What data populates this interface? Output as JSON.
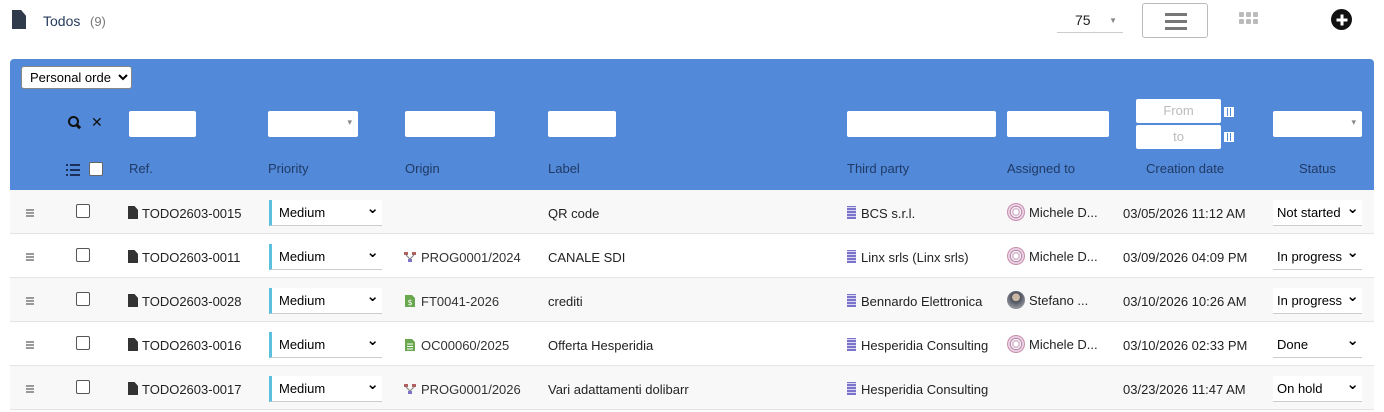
{
  "header": {
    "title": "Todos",
    "count": "(9)",
    "per_page": "75"
  },
  "filters": {
    "sort_option": "Personal order",
    "date_from": "From",
    "date_to": "to"
  },
  "columns": {
    "ref": "Ref.",
    "priority": "Priority",
    "origin": "Origin",
    "label": "Label",
    "third_party": "Third party",
    "assigned_to": "Assigned to",
    "creation_date": "Creation date",
    "status": "Status"
  },
  "rows": [
    {
      "ref": "TODO2603-0015",
      "priority": "Medium",
      "origin": "",
      "origin_icon": "",
      "label": "QR code",
      "third_party": "BCS s.r.l.",
      "assigned": "Michele D...",
      "avatar": "pink",
      "date": "03/05/2026 11:12 AM",
      "status": "Not started"
    },
    {
      "ref": "TODO2603-0011",
      "priority": "Medium",
      "origin": "PROG0001/2024",
      "origin_icon": "project-icon",
      "label": "CANALE SDI",
      "third_party": "Linx srls (Linx srls)",
      "assigned": "Michele D...",
      "avatar": "pink",
      "date": "03/09/2026 04:09 PM",
      "status": "In progress"
    },
    {
      "ref": "TODO2603-0028",
      "priority": "Medium",
      "origin": "FT0041-2026",
      "origin_icon": "invoice-icon",
      "label": "crediti",
      "third_party": "Bennardo Elettronica",
      "assigned": "Stefano ...",
      "avatar": "photo",
      "date": "03/10/2026 10:26 AM",
      "status": "In progress"
    },
    {
      "ref": "TODO2603-0016",
      "priority": "Medium",
      "origin": "OC00060/2025",
      "origin_icon": "order-icon",
      "label": "Offerta Hesperidia",
      "third_party": "Hesperidia Consulting",
      "assigned": "Michele D...",
      "avatar": "pink",
      "date": "03/10/2026 02:33 PM",
      "status": "Done"
    },
    {
      "ref": "TODO2603-0017",
      "priority": "Medium",
      "origin": "PROG0001/2026",
      "origin_icon": "project-icon",
      "label": "Vari adattamenti dolibarr",
      "third_party": "Hesperidia Consulting",
      "assigned": "",
      "avatar": "",
      "date": "03/23/2026 11:47 AM",
      "status": "On hold"
    }
  ]
}
